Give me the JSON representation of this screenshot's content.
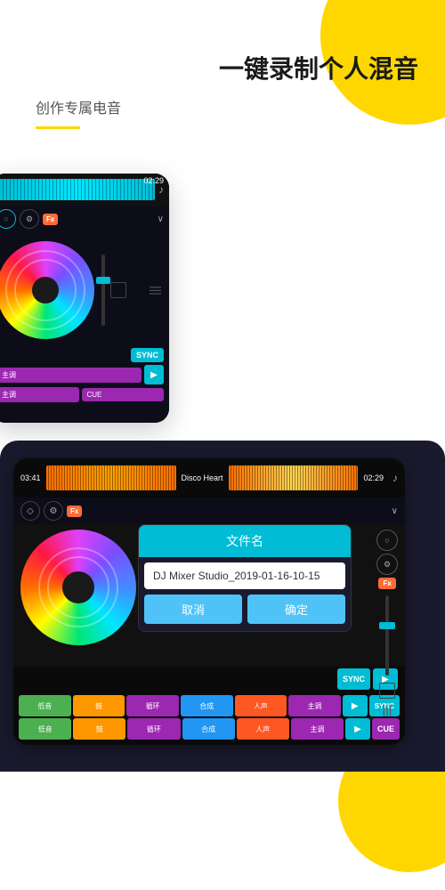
{
  "background": {
    "blob_top": "yellow circle decoration",
    "blob_bottom": "yellow circle decoration"
  },
  "top_section": {
    "headline": "一键录制个人混音",
    "subtext": "创作专属电音",
    "yellow_divider": true
  },
  "device1": {
    "time": "02:29",
    "controls": [
      "○",
      "⚙",
      "Fx"
    ],
    "buttons": {
      "sync": "SYNC",
      "play": "▶",
      "key1": "主调",
      "key2": "主调",
      "cue": "CUE"
    }
  },
  "device2": {
    "time_left": "03:41",
    "title": "Disco Heart",
    "time_right": "02:29",
    "controls": [
      "◇",
      "⚙",
      "Fx"
    ],
    "dialog": {
      "title": "文件名",
      "input_value": "DJ Mixer Studio_2019-01-16-10-15",
      "cancel": "取消",
      "confirm": "确定"
    },
    "buttons": {
      "sync": "SYNC",
      "play": "▶",
      "cue": "CUE"
    },
    "pad_rows": [
      [
        "低音",
        "鼓",
        "循环",
        "合成",
        "人声",
        "主调"
      ],
      [
        "低音",
        "鼓",
        "循环",
        "合成",
        "人声",
        "主调"
      ]
    ]
  }
}
